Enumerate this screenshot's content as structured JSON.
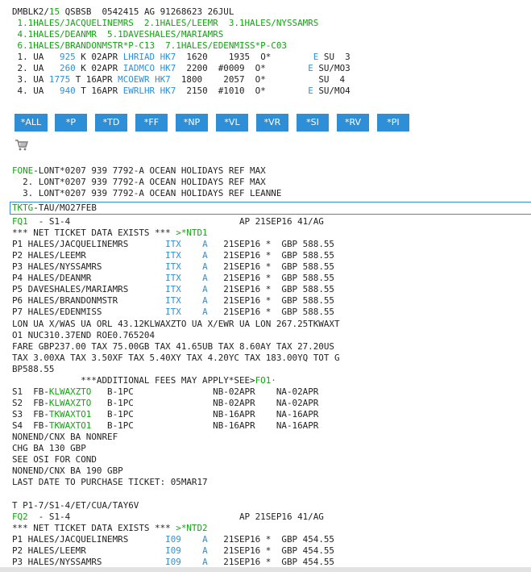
{
  "pnr": {
    "header": {
      "a": "DMBLK2/",
      "b": "15",
      "c": " QSBSB  0542415 AG 91268623 26JUL"
    },
    "names": [
      " 1.1HALES/JACQUELINEMRS  2.1HALES/LEEMR  3.1HALES/NYSSAMRS",
      " 4.1HALES/DEANMR  5.1DAVESHALES/MARIAMRS",
      " 6.1HALES/BRANDONMSTR*P-C13  7.1HALES/EDENMISS*P-C03"
    ],
    "segments": [
      {
        "a": " 1. UA  ",
        "flight": " 925",
        "b": " K 02APR ",
        "route": "LHRIAD",
        "c": " ",
        "status": "HK7",
        "d": "  1620    1935  O*        ",
        "e": "E",
        "f": " SU  3"
      },
      {
        "a": " 2. UA  ",
        "flight": " 260",
        "b": " K 02APR ",
        "route": "IADMCO",
        "c": " ",
        "status": "HK7",
        "d": "  2200  #0009  O*        ",
        "e": "E",
        "f": " SU/MO3"
      },
      {
        "a": " 3. UA ",
        "flight": "1775",
        "b": " T 16APR ",
        "route": "MCOEWR",
        "c": " ",
        "status": "HK7",
        "d": "  1800    2057  O*        ",
        "e": "",
        "f": "  SU  4"
      },
      {
        "a": " 4. UA  ",
        "flight": " 940",
        "b": " T 16APR ",
        "route": "EWRLHR",
        "c": " ",
        "status": "HK7",
        "d": "  2150  #1010  O*        ",
        "e": "E",
        "f": " SU/MO4"
      }
    ]
  },
  "buttons": [
    "*ALL",
    "*P",
    "*TD",
    "*FF",
    "*NP",
    "*VL",
    "*VR",
    "*SI",
    "*RV",
    "*PI"
  ],
  "cart_icon": "shopping-cart-icon",
  "fone": {
    "first": {
      "key": "FONE",
      "text": "-LONT*0207 939 7792-A OCEAN HOLIDAYS REF MAX"
    },
    "lines": [
      "  2. LONT*0207 939 7792-A OCEAN HOLIDAYS REF MAX",
      "  3. LONT*0207 939 7792-A OCEAN HOLIDAYS REF LEANNE"
    ]
  },
  "tktg": {
    "key": "TKTG",
    "text": "-TAU/MO27FEB"
  },
  "fq1": {
    "key": "FQ1",
    "header_rest": "  - S1-4                                AP 21SEP16 41/AG",
    "net_line": {
      "text": "*** NET TICKET DATA EXISTS *** ",
      "link": ">*NTD1"
    },
    "pax": [
      {
        "a": "P1 HALES/JACQUELINEMRS       ",
        "code": "ITX",
        "b": "    ",
        "c": "A",
        "d": "   21SEP16 *  GBP 588.55"
      },
      {
        "a": "P2 HALES/LEEMR               ",
        "code": "ITX",
        "b": "    ",
        "c": "A",
        "d": "   21SEP16 *  GBP 588.55"
      },
      {
        "a": "P3 HALES/NYSSAMRS            ",
        "code": "ITX",
        "b": "    ",
        "c": "A",
        "d": "   21SEP16 *  GBP 588.55"
      },
      {
        "a": "P4 HALES/DEANMR              ",
        "code": "ITX",
        "b": "    ",
        "c": "A",
        "d": "   21SEP16 *  GBP 588.55"
      },
      {
        "a": "P5 DAVESHALES/MARIAMRS       ",
        "code": "ITX",
        "b": "    ",
        "c": "A",
        "d": "   21SEP16 *  GBP 588.55"
      },
      {
        "a": "P6 HALES/BRANDONMSTR         ",
        "code": "ITX",
        "b": "    ",
        "c": "A",
        "d": "   21SEP16 *  GBP 588.55"
      },
      {
        "a": "P7 HALES/EDENMISS            ",
        "code": "ITX",
        "b": "    ",
        "c": "A",
        "d": "   21SEP16 *  GBP 588.55"
      }
    ],
    "fare_lines": [
      "LON UA X/WAS UA ORL 43.12KLWAXZTO UA X/EWR UA LON 267.25TKWAXT",
      "O1 NUC310.37END ROE0.765204",
      "FARE GBP237.00 TAX 75.00GB TAX 41.65UB TAX 8.60AY TAX 27.20US",
      "TAX 3.00XA TAX 3.50XF TAX 5.40XY TAX 4.20YC TAX 183.00YQ TOT G",
      "BP588.55"
    ],
    "fees": {
      "text": "             ***ADDITIONAL FEES MAY APPLY*SEE>",
      "link": "FO1·"
    },
    "fare_basis": [
      {
        "a": "S1  FB-",
        "fb": "KLWAXZTO",
        "b": "   B-1PC               NB-02APR    NA-02APR"
      },
      {
        "a": "S2  FB-",
        "fb": "KLWAXZTO",
        "b": "   B-1PC               NB-02APR    NA-02APR"
      },
      {
        "a": "S3  FB-",
        "fb": "TKWAXTO1",
        "b": "   B-1PC               NB-16APR    NA-16APR"
      },
      {
        "a": "S4  FB-",
        "fb": "TKWAXTO1",
        "b": "   B-1PC               NB-16APR    NA-16APR"
      }
    ],
    "notes": [
      "NONEND/CNX BA NONREF",
      "CHG BA 130 GBP",
      "SEE OSI FOR COND",
      "NONEND/CNX BA 190 GBP",
      "LAST DATE TO PURCHASE TICKET: 05MAR17"
    ],
    "t_line": "T P1-7/S1-4/ET/CUA/TAY6V"
  },
  "fq2": {
    "key": "FQ2",
    "header_rest": "  - S1-4                                AP 21SEP16 41/AG",
    "net_line": {
      "text": "*** NET TICKET DATA EXISTS *** ",
      "link": ">*NTD2"
    },
    "pax": [
      {
        "a": "P1 HALES/JACQUELINEMRS       ",
        "code": "I09",
        "b": "    ",
        "c": "A",
        "d": "   21SEP16 *  GBP 454.55"
      },
      {
        "a": "P2 HALES/LEEMR               ",
        "code": "I09",
        "b": "    ",
        "c": "A",
        "d": "   21SEP16 *  GBP 454.55"
      },
      {
        "a": "P3 HALES/NYSSAMRS            ",
        "code": "I09",
        "b": "    ",
        "c": "A",
        "d": "   21SEP16 *  GBP 454.55"
      }
    ]
  }
}
